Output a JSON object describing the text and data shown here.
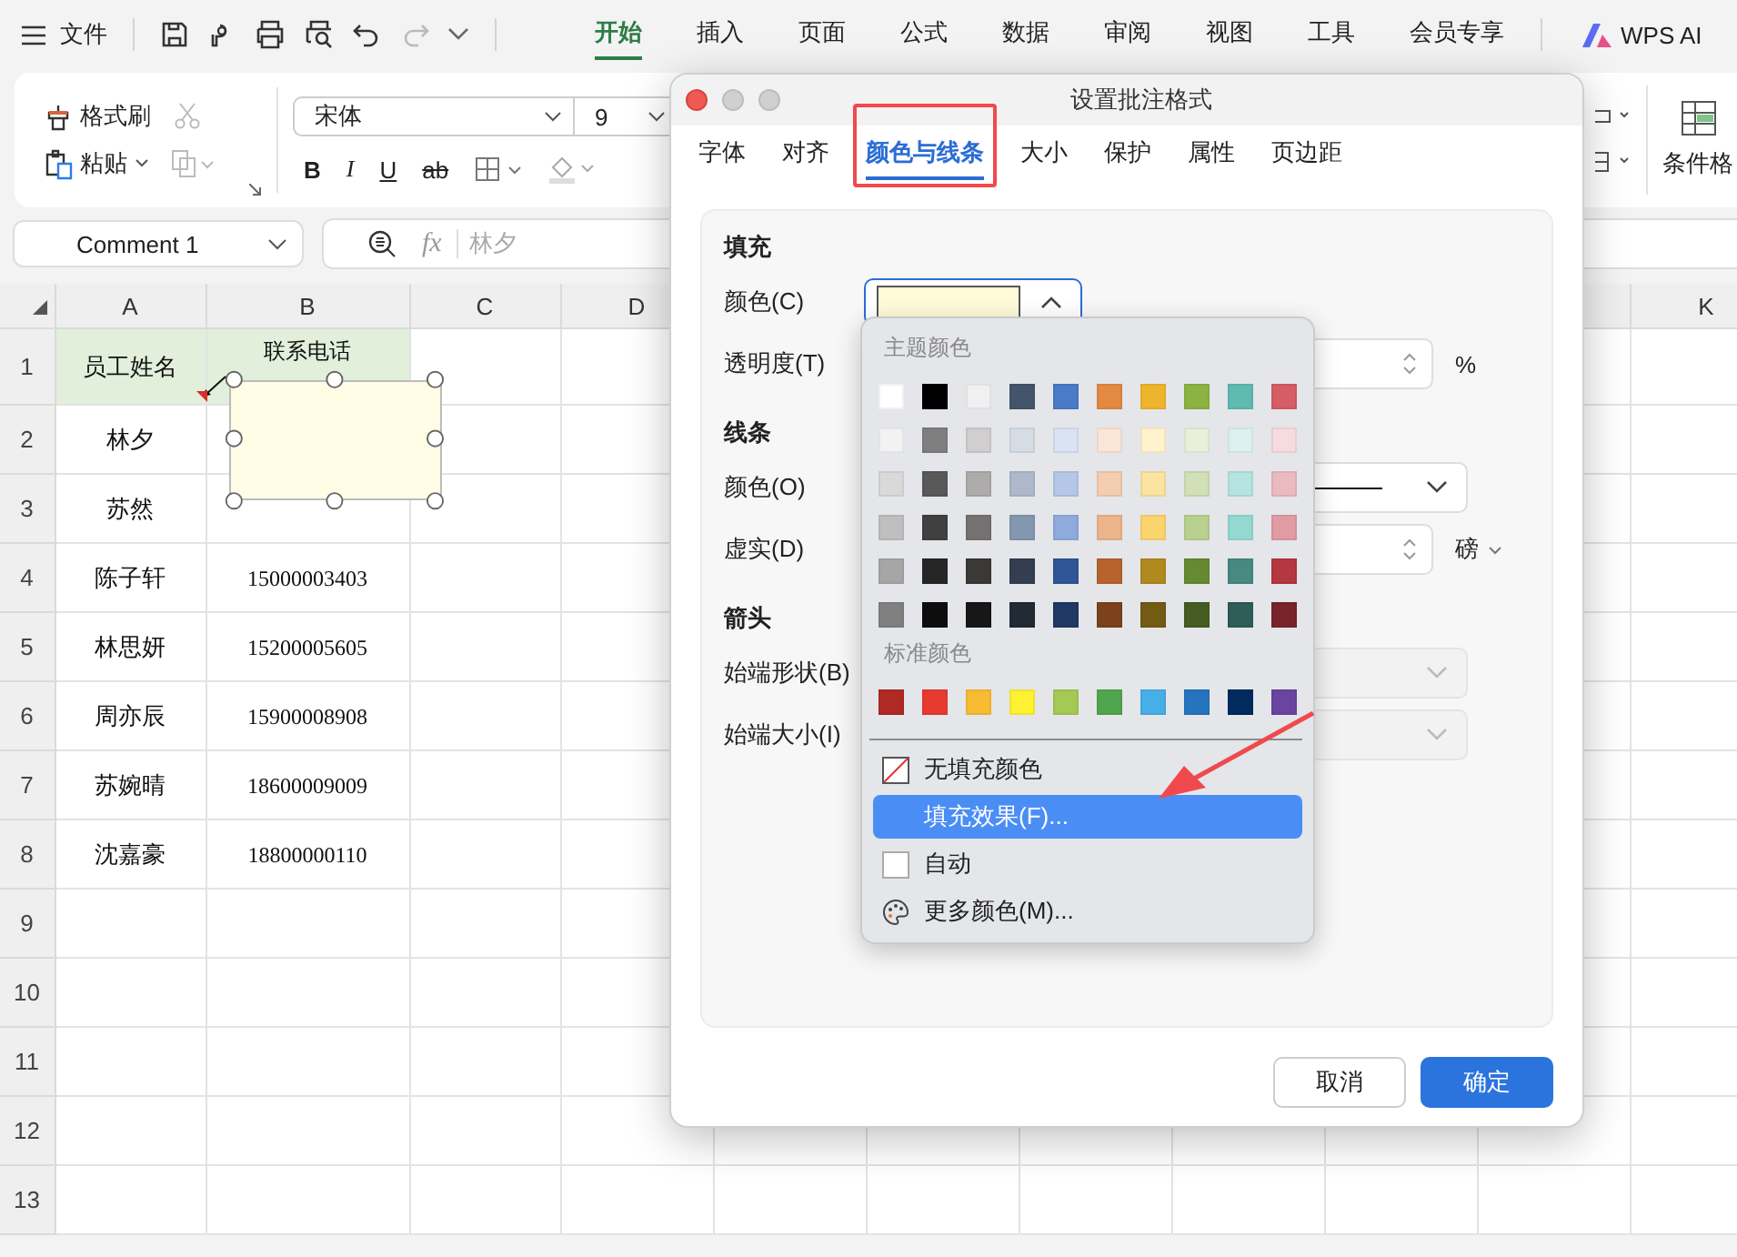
{
  "menubar": {
    "file_label": "文件",
    "tabs": [
      {
        "label": "开始",
        "selected": true
      },
      {
        "label": "插入",
        "selected": false
      },
      {
        "label": "页面",
        "selected": false
      },
      {
        "label": "公式",
        "selected": false
      },
      {
        "label": "数据",
        "selected": false
      },
      {
        "label": "审阅",
        "selected": false
      },
      {
        "label": "视图",
        "selected": false
      },
      {
        "label": "工具",
        "selected": false
      },
      {
        "label": "会员专享",
        "selected": false
      }
    ],
    "ai_label": "WPS AI"
  },
  "ribbon": {
    "format_painter": "格式刷",
    "paste": "粘贴",
    "font": "宋体",
    "font_size": "9",
    "format_buttons": [
      "B",
      "I",
      "U",
      "ab"
    ],
    "conditional_format": "条件格"
  },
  "formula_bar": {
    "name_box": "Comment 1",
    "fx_label": "fx",
    "value": "林夕"
  },
  "sheet": {
    "columns_left": [
      "A",
      "B",
      "C",
      "D"
    ],
    "columns_right": [
      "K"
    ],
    "rows": [
      {
        "number": "1",
        "header": true,
        "cells": [
          "员工姓名",
          "联系电话"
        ]
      },
      {
        "number": "2",
        "header": false,
        "cells": [
          "林夕"
        ]
      },
      {
        "number": "3",
        "header": false,
        "cells": [
          "苏然"
        ]
      },
      {
        "number": "4",
        "header": false,
        "cells": [
          "陈子轩",
          "15000003403"
        ]
      },
      {
        "number": "5",
        "header": false,
        "cells": [
          "林思妍",
          "15200005605"
        ]
      },
      {
        "number": "6",
        "header": false,
        "cells": [
          "周亦辰",
          "15900008908"
        ]
      },
      {
        "number": "7",
        "header": false,
        "cells": [
          "苏婉晴",
          "18600009009"
        ]
      },
      {
        "number": "8",
        "header": false,
        "cells": [
          "沈嘉豪",
          "18800000110"
        ]
      },
      {
        "number": "9",
        "header": false,
        "cells": []
      },
      {
        "number": "10",
        "header": false,
        "cells": []
      },
      {
        "number": "11",
        "header": false,
        "cells": []
      },
      {
        "number": "12",
        "header": false,
        "cells": []
      },
      {
        "number": "13",
        "header": false,
        "cells": []
      }
    ]
  },
  "dialog": {
    "title": "设置批注格式",
    "tabs": [
      {
        "label": "字体",
        "selected": false
      },
      {
        "label": "对齐",
        "selected": false
      },
      {
        "label": "颜色与线条",
        "selected": true
      },
      {
        "label": "大小",
        "selected": false
      },
      {
        "label": "保护",
        "selected": false
      },
      {
        "label": "属性",
        "selected": false
      },
      {
        "label": "页边距",
        "selected": false
      }
    ],
    "fill_heading": "填充",
    "fill_color_label": "颜色(C)",
    "transparency_label": "透明度(T)",
    "transparency_unit": "%",
    "line_heading": "线条",
    "line_color_label": "颜色(O)",
    "dash_label": "虚实(D)",
    "weight_unit": "磅",
    "arrow_heading": "箭头",
    "begin_style_label": "始端形状(B)",
    "begin_size_label": "始端大小(I)",
    "buttons": [
      {
        "label": "取消",
        "primary": false
      },
      {
        "label": "确定",
        "primary": true
      }
    ]
  },
  "palette": {
    "theme_label": "主题颜色",
    "theme_rows": [
      [
        {
          "color": "#ffffff"
        },
        {
          "color": "#000000"
        },
        {
          "color": "#f0f0f0"
        },
        {
          "color": "#44546a"
        },
        {
          "color": "#4a7bc8"
        },
        {
          "color": "#e38942"
        },
        {
          "color": "#edb52e"
        },
        {
          "color": "#8ab342"
        },
        {
          "color": "#5fbab0"
        },
        {
          "color": "#d65c66"
        }
      ],
      [
        {
          "color": "#f2f2f2"
        },
        {
          "color": "#7f7f7f"
        },
        {
          "color": "#d0cece"
        },
        {
          "color": "#d6dce4"
        },
        {
          "color": "#dae3f3"
        },
        {
          "color": "#fbe5d6"
        },
        {
          "color": "#fff2cc"
        },
        {
          "color": "#e8f0da"
        },
        {
          "color": "#dcf1ef"
        },
        {
          "color": "#f6dbdf"
        }
      ],
      [
        {
          "color": "#d9d9d9"
        },
        {
          "color": "#595959"
        },
        {
          "color": "#aeabab"
        },
        {
          "color": "#adb9ca"
        },
        {
          "color": "#b4c7e7"
        },
        {
          "color": "#f4cdb0"
        },
        {
          "color": "#fbe3a0"
        },
        {
          "color": "#d1e0b6"
        },
        {
          "color": "#b5e3df"
        },
        {
          "color": "#ebb9c0"
        }
      ],
      [
        {
          "color": "#bfbfbf"
        },
        {
          "color": "#404040"
        },
        {
          "color": "#767171"
        },
        {
          "color": "#8497b0"
        },
        {
          "color": "#8faadc"
        },
        {
          "color": "#ecb48a"
        },
        {
          "color": "#fad46d"
        },
        {
          "color": "#b8d18f"
        },
        {
          "color": "#93d9d2"
        },
        {
          "color": "#e29aa3"
        }
      ],
      [
        {
          "color": "#a6a6a6"
        },
        {
          "color": "#262626"
        },
        {
          "color": "#3b3838"
        },
        {
          "color": "#333f50"
        },
        {
          "color": "#2f5597"
        },
        {
          "color": "#b8632d"
        },
        {
          "color": "#b0891f"
        },
        {
          "color": "#668a32"
        },
        {
          "color": "#468a82"
        },
        {
          "color": "#b53740"
        }
      ],
      [
        {
          "color": "#808080"
        },
        {
          "color": "#0d0d0d"
        },
        {
          "color": "#171717"
        },
        {
          "color": "#222a35"
        },
        {
          "color": "#1f3864"
        },
        {
          "color": "#7b421b"
        },
        {
          "color": "#735b14"
        },
        {
          "color": "#445c21"
        },
        {
          "color": "#2e5c56"
        },
        {
          "color": "#79242b"
        }
      ]
    ],
    "standard_label": "标准颜色",
    "standard_colors": [
      {
        "color": "#b02a24"
      },
      {
        "color": "#e83b30"
      },
      {
        "color": "#f8bc33"
      },
      {
        "color": "#fef233"
      },
      {
        "color": "#a5c955"
      },
      {
        "color": "#50a64e"
      },
      {
        "color": "#47afe8"
      },
      {
        "color": "#2474c0"
      },
      {
        "color": "#012a5e"
      },
      {
        "color": "#6a44a0"
      }
    ],
    "items": [
      {
        "kind": "none",
        "label": "无填充颜色",
        "selected": false
      },
      {
        "kind": "effect",
        "label": "填充效果(F)...",
        "selected": true
      },
      {
        "kind": "auto",
        "label": "自动",
        "selected": false
      },
      {
        "kind": "more",
        "label": "更多颜色(M)...",
        "selected": false
      }
    ]
  }
}
